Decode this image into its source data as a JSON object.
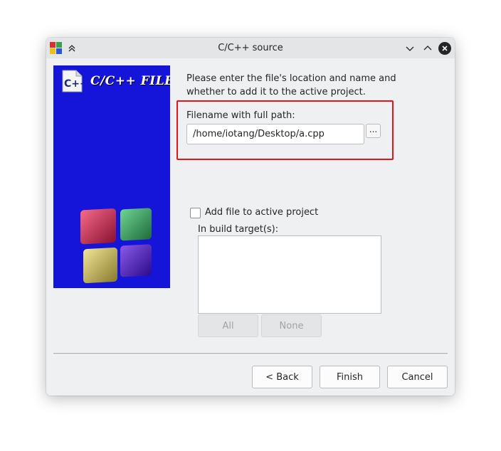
{
  "window": {
    "title": "C/C++ source"
  },
  "banner": {
    "title": "C/C++ FILE",
    "logo_text": "C++"
  },
  "intro": {
    "text": "Please enter the file's location and name and whether to add it to the active project."
  },
  "filename": {
    "label": "Filename with full path:",
    "value": "/home/iotang/Desktop/a.cpp",
    "browse_label": "..."
  },
  "add_to_project": {
    "label": "Add file to active project",
    "checked": false
  },
  "build_targets": {
    "label": "In build target(s):",
    "items": []
  },
  "target_buttons": {
    "all_label": "All",
    "none_label": "None"
  },
  "footer": {
    "back_label": "< Back",
    "finish_label": "Finish",
    "cancel_label": "Cancel"
  },
  "colors": {
    "banner_bg": "#1515d9",
    "highlight_border": "#e8121a",
    "window_bg": "#eff0f1"
  },
  "icons": [
    "app-icon",
    "keep-above-icon",
    "minimize-icon",
    "maximize-icon",
    "close-icon",
    "cpp-file-logo-icon",
    "codeblocks-cubes-icon"
  ]
}
